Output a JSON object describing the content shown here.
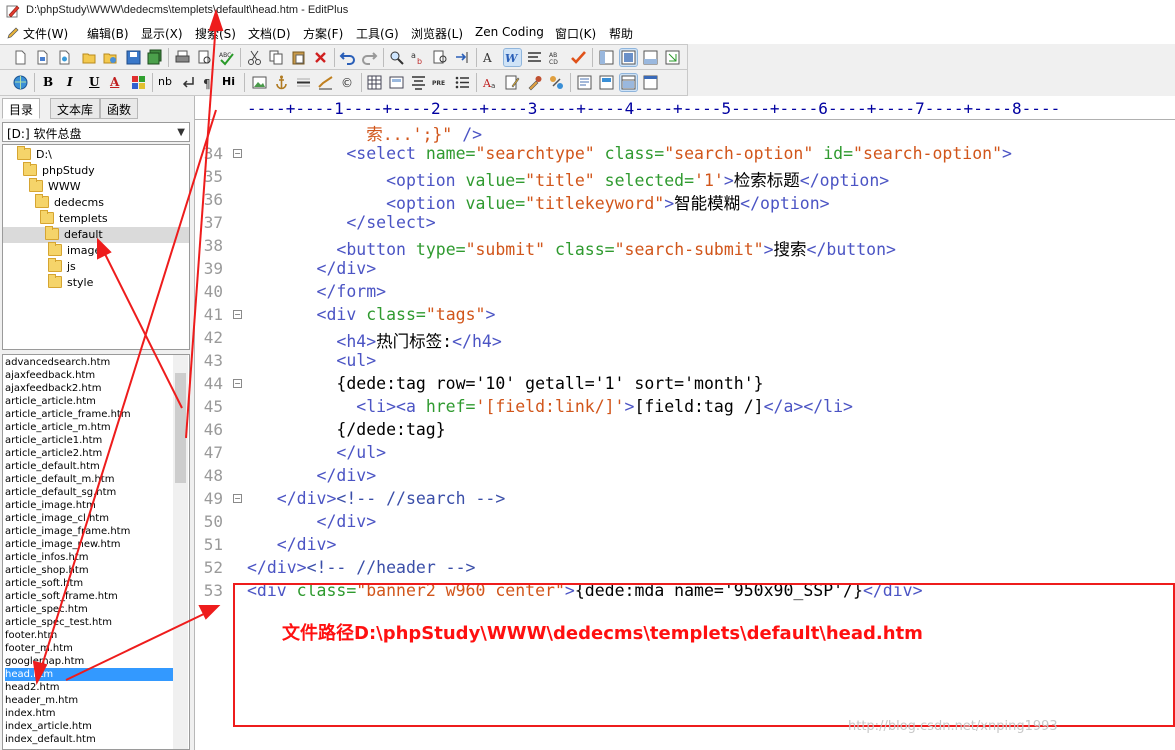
{
  "window": {
    "title": "D:\\phpStudy\\WWW\\dedecms\\templets\\default\\head.htm - EditPlus"
  },
  "menu": [
    "文件(W)",
    "编辑(B)",
    "显示(X)",
    "搜索(S)",
    "文档(D)",
    "方案(F)",
    "工具(G)",
    "浏览器(L)",
    "Zen Coding",
    "窗口(K)",
    "帮助"
  ],
  "toolbar2_text": {
    "bold": "B",
    "italic": "I",
    "underline": "U",
    "font_color": "A",
    "nb": "nb",
    "hi": "Hi",
    "pre": "PRE"
  },
  "left_tabs": [
    "目录",
    "文本库",
    "函数"
  ],
  "drive": "[D:] 软件总盘",
  "tree": [
    "D:\\",
    "phpStudy",
    "WWW",
    "dedecms",
    "templets",
    "default",
    "images",
    "js",
    "style"
  ],
  "files": [
    "advancedsearch.htm",
    "ajaxfeedback.htm",
    "ajaxfeedback2.htm",
    "article_article.htm",
    "article_article_frame.htm",
    "article_article_m.htm",
    "article_article1.htm",
    "article_article2.htm",
    "article_default.htm",
    "article_default_m.htm",
    "article_default_sg.htm",
    "article_image.htm",
    "article_image_cl.htm",
    "article_image_frame.htm",
    "article_image_new.htm",
    "article_infos.htm",
    "article_shop.htm",
    "article_soft.htm",
    "article_soft_frame.htm",
    "article_spec.htm",
    "article_spec_test.htm",
    "footer.htm",
    "footer_m.htm",
    "googlemap.htm",
    "head.htm",
    "head2.htm",
    "header_m.htm",
    "index.htm",
    "index_article.htm",
    "index_default.htm"
  ],
  "selected_file": "head.htm",
  "ruler": "----+----1----+----2----+----3----+----4----+----5----+----6----+----7----+----8----",
  "code_lines": [
    {
      "n": "",
      "fold": false,
      "segs": [
        [
          "str",
          "            索...';}\""
        ],
        [
          "txt",
          " "
        ],
        [
          "tag",
          "/>"
        ]
      ]
    },
    {
      "n": "34",
      "fold": true,
      "segs": [
        [
          "tag",
          "          <select "
        ],
        [
          "attr",
          "name="
        ],
        [
          "str",
          "\"searchtype\""
        ],
        [
          "attr",
          " class="
        ],
        [
          "str",
          "\"search-option\""
        ],
        [
          "attr",
          " id="
        ],
        [
          "str",
          "\"search-option\""
        ],
        [
          "tag",
          ">"
        ]
      ]
    },
    {
      "n": "35",
      "fold": false,
      "segs": [
        [
          "tag",
          "              <option "
        ],
        [
          "attr",
          "value="
        ],
        [
          "str",
          "\"title\""
        ],
        [
          "attr",
          " selected="
        ],
        [
          "str",
          "'1'"
        ],
        [
          "tag",
          ">"
        ],
        [
          "txt",
          "检索标题"
        ],
        [
          "tag",
          "</option>"
        ]
      ]
    },
    {
      "n": "36",
      "fold": false,
      "segs": [
        [
          "tag",
          "              <option "
        ],
        [
          "attr",
          "value="
        ],
        [
          "str",
          "\"titlekeyword\""
        ],
        [
          "tag",
          ">"
        ],
        [
          "txt",
          "智能模糊"
        ],
        [
          "tag",
          "</option>"
        ]
      ]
    },
    {
      "n": "37",
      "fold": false,
      "segs": [
        [
          "tag",
          "          </select>"
        ]
      ]
    },
    {
      "n": "38",
      "fold": false,
      "segs": [
        [
          "tag",
          "         <button "
        ],
        [
          "attr",
          "type="
        ],
        [
          "str",
          "\"submit\""
        ],
        [
          "attr",
          " class="
        ],
        [
          "str",
          "\"search-submit\""
        ],
        [
          "tag",
          ">"
        ],
        [
          "txt",
          "搜索"
        ],
        [
          "tag",
          "</button>"
        ]
      ]
    },
    {
      "n": "39",
      "fold": false,
      "segs": [
        [
          "tag",
          "       </div>"
        ]
      ]
    },
    {
      "n": "40",
      "fold": false,
      "segs": [
        [
          "tag",
          "       </form>"
        ]
      ]
    },
    {
      "n": "41",
      "fold": true,
      "segs": [
        [
          "tag",
          "       <div "
        ],
        [
          "attr",
          "class="
        ],
        [
          "str",
          "\"tags\""
        ],
        [
          "tag",
          ">"
        ]
      ]
    },
    {
      "n": "42",
      "fold": false,
      "segs": [
        [
          "tag",
          "         <h4>"
        ],
        [
          "txt",
          "热门标签:"
        ],
        [
          "tag",
          "</h4>"
        ]
      ]
    },
    {
      "n": "43",
      "fold": false,
      "segs": [
        [
          "tag",
          "         <ul>"
        ]
      ]
    },
    {
      "n": "44",
      "fold": true,
      "segs": [
        [
          "txt",
          "         {dede:tag row='10' getall='1' sort='month'}"
        ]
      ]
    },
    {
      "n": "45",
      "fold": false,
      "segs": [
        [
          "tag",
          "           <li><a "
        ],
        [
          "attr",
          "href="
        ],
        [
          "str",
          "'[field:link/]'"
        ],
        [
          "tag",
          ">"
        ],
        [
          "txt",
          "[field:tag /]"
        ],
        [
          "tag",
          "</a></li>"
        ]
      ]
    },
    {
      "n": "46",
      "fold": false,
      "segs": [
        [
          "txt",
          "         {/dede:tag}"
        ]
      ]
    },
    {
      "n": "47",
      "fold": false,
      "segs": [
        [
          "tag",
          "         </ul>"
        ]
      ]
    },
    {
      "n": "48",
      "fold": false,
      "segs": [
        [
          "tag",
          "       </div>"
        ]
      ]
    },
    {
      "n": "49",
      "fold": true,
      "segs": [
        [
          "tag",
          "   </div>"
        ],
        [
          "cmt",
          "<!-- //search -->"
        ]
      ]
    },
    {
      "n": "50",
      "fold": false,
      "segs": [
        [
          "tag",
          "       </div>"
        ]
      ]
    },
    {
      "n": "51",
      "fold": false,
      "segs": [
        [
          "tag",
          "   </div>"
        ]
      ]
    },
    {
      "n": "52",
      "fold": false,
      "segs": [
        [
          "tag",
          "</div>"
        ],
        [
          "cmt",
          "<!-- //header -->"
        ]
      ]
    },
    {
      "n": "53",
      "fold": false,
      "segs": [
        [
          "tag",
          "<div "
        ],
        [
          "attr",
          "class="
        ],
        [
          "str",
          "\"banner2 w960 center\""
        ],
        [
          "tag",
          ">"
        ],
        [
          "txt",
          "{dede:mda name='950x90_SSP'/}"
        ],
        [
          "tag",
          "</div>"
        ]
      ]
    }
  ],
  "annotation": "文件路径D:\\phpStudy\\WWW\\dedecms\\templets\\default\\head.htm",
  "watermark": "http://blog.csdn.net/xnping1993",
  "colors": {
    "tag": "#4b54c4",
    "attr": "#2f9a2f",
    "string": "#d1551a",
    "annotation": "#ee1c1c",
    "selection": "#3399ff"
  }
}
